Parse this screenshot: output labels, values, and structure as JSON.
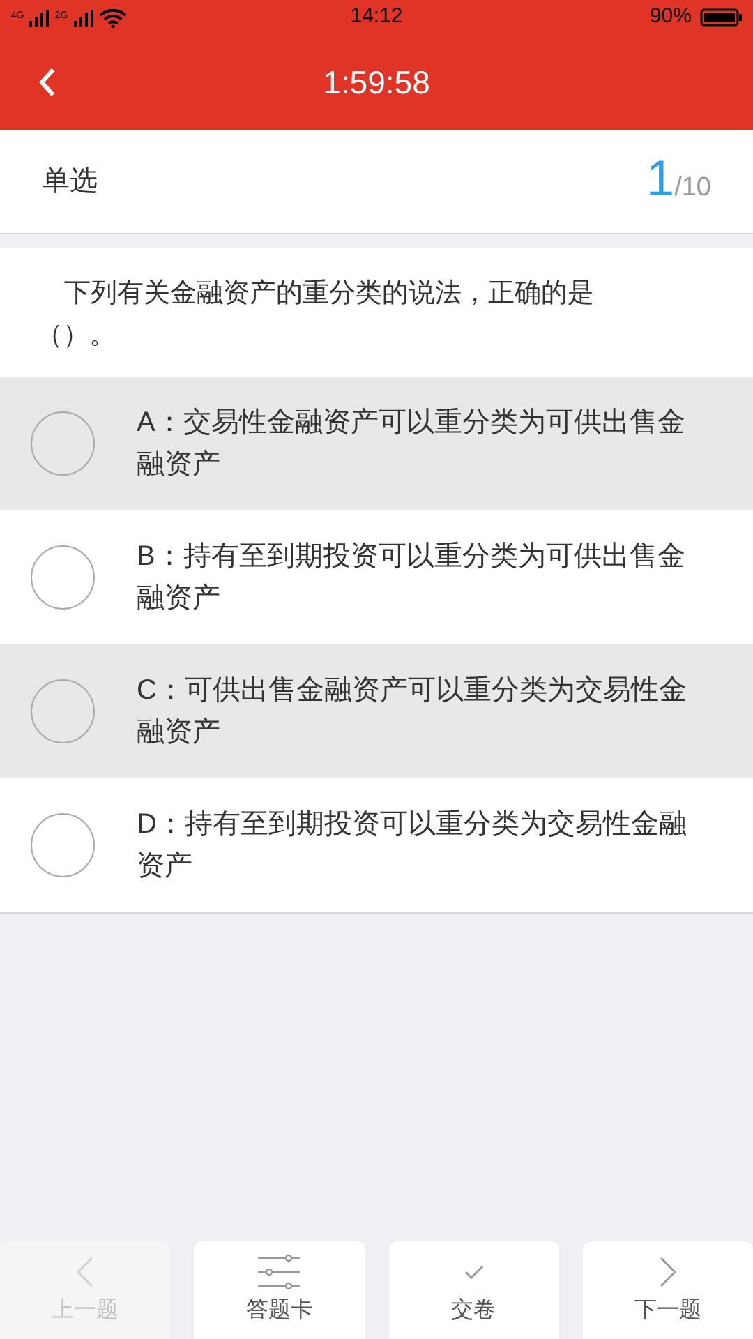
{
  "status_bar": {
    "network_1": "4G",
    "network_2": "2G",
    "time": "14:12",
    "battery": "90%"
  },
  "header": {
    "timer": "1:59:58"
  },
  "question_type": "单选",
  "progress": {
    "current": "1",
    "total": "/10"
  },
  "question": "下列有关金融资产的重分类的说法，正确的是（）。",
  "options": [
    {
      "text": "A：交易性金融资产可以重分类为可供出售金融资产",
      "selected": false
    },
    {
      "text": "B：持有至到期投资可以重分类为可供出售金融资产",
      "selected": false
    },
    {
      "text": "C：可供出售金融资产可以重分类为交易性金融资产",
      "selected": false
    },
    {
      "text": "D：持有至到期投资可以重分类为交易性金融资产",
      "selected": false
    }
  ],
  "bottom_nav": [
    {
      "kind": "prev",
      "label": "上一题",
      "disabled": true
    },
    {
      "kind": "card",
      "label": "答题卡",
      "disabled": false
    },
    {
      "kind": "submit",
      "label": "交卷",
      "disabled": false
    },
    {
      "kind": "next",
      "label": "下一题",
      "disabled": false
    }
  ]
}
